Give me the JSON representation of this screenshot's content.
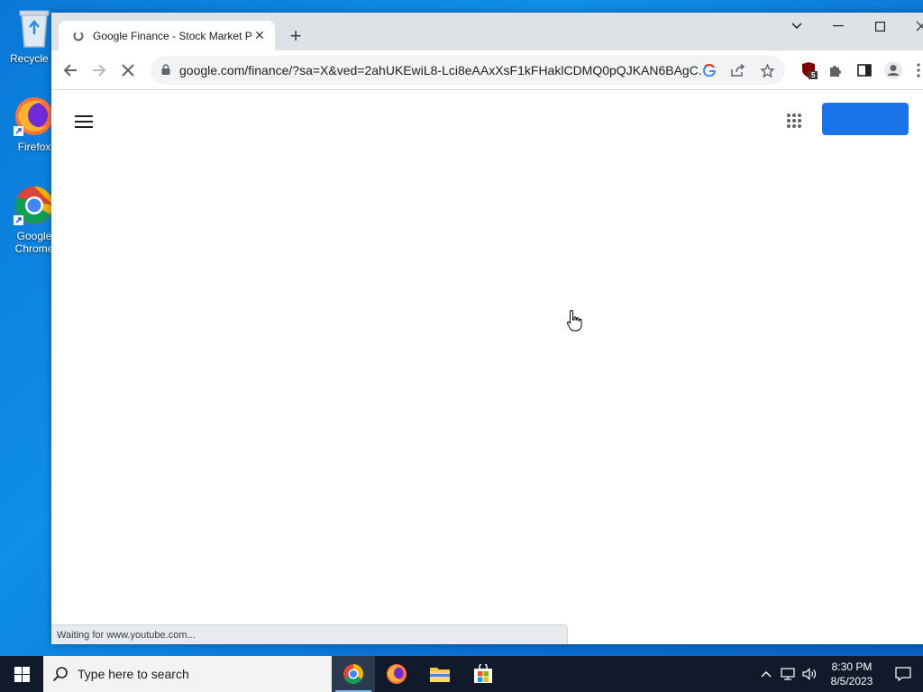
{
  "desktop": {
    "icons": [
      {
        "label": "Recycle Bin",
        "display": "Recycle B"
      },
      {
        "label": "Firefox",
        "display": "Firefox"
      },
      {
        "label": "Google Chrome",
        "display": "Google Chrome"
      }
    ]
  },
  "browser": {
    "tab": {
      "title": "Google Finance - Stock Market P",
      "favicon": "loading-icon"
    },
    "new_tab_label": "+",
    "url": "google.com/finance/?sa=X&ved=2ahUKEwiL8-Lci8eAAxXsF1kFHaklCDMQ0pQJKAN6BAgC...",
    "extension_badge": "5",
    "status": "Waiting for www.youtube.com..."
  },
  "page": {
    "signin_label": ""
  },
  "taskbar": {
    "search_placeholder": "Type here to search",
    "time": "8:30 PM",
    "date": "8/5/2023"
  },
  "colors": {
    "accent": "#1a73e8",
    "taskbar": "#101a2b",
    "desktop": "#0a78d7"
  }
}
